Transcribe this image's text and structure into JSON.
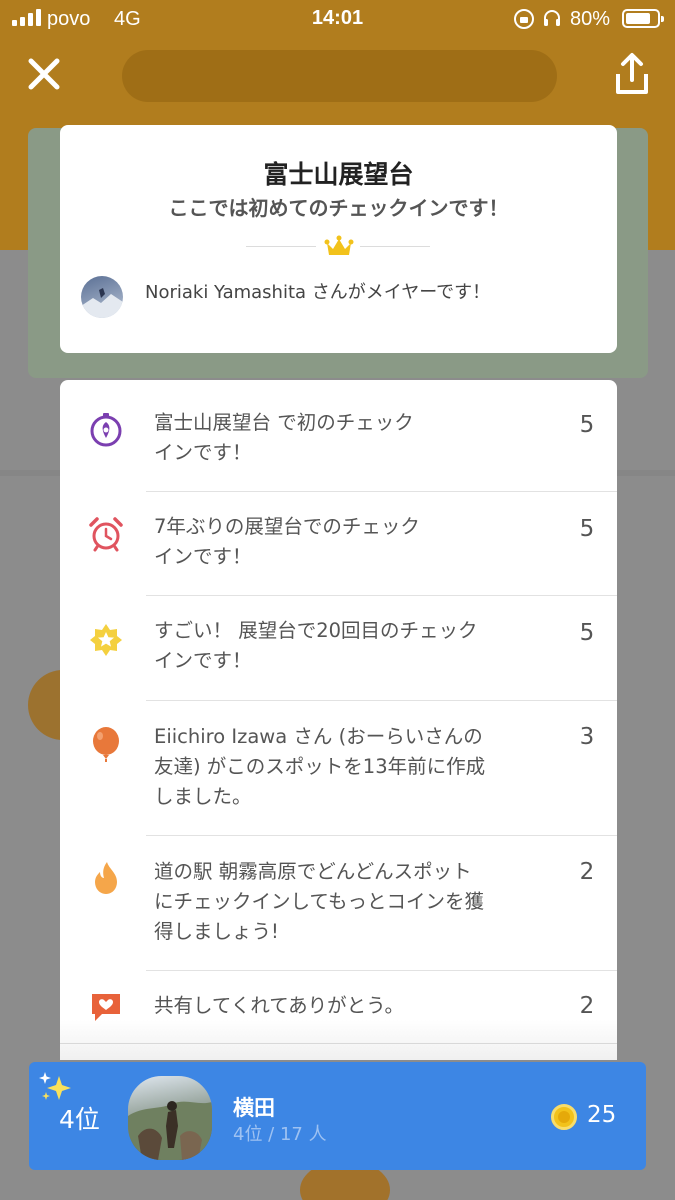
{
  "status_bar": {
    "carrier": "povo",
    "network": "4G",
    "time": "14:01",
    "battery": "80%",
    "battery_level": 0.8
  },
  "header": {
    "close_icon": "close-icon",
    "share_icon": "share-icon"
  },
  "venue_card": {
    "title": "富士山展望台",
    "subtitle": "ここでは初めてのチェックインです！",
    "mayor_text": "Noriaki Yamashita さんがメイヤーです！",
    "crown_icon": "crown-icon"
  },
  "bonuses": [
    {
      "icon": "compass-icon",
      "color": "#7b3fb0",
      "lines": [
        "富士山展望台 で初のチェック",
        "インです！"
      ],
      "points": "5"
    },
    {
      "icon": "alarm-clock-icon",
      "color": "#e0545f",
      "lines": [
        "7年ぶりの展望台でのチェック",
        "インです！"
      ],
      "points": "5"
    },
    {
      "icon": "star-badge-icon",
      "color": "#f4d03f",
      "lines": [
        "すごい！ 展望台で20回目のチェック",
        "インです！"
      ],
      "points": "5"
    },
    {
      "icon": "balloon-icon",
      "color": "#e8783a",
      "lines": [
        "Eiichiro Izawa さん (おーらいさんの",
        "友達) がこのスポットを13年前に作成",
        "しました。"
      ],
      "points": "3"
    },
    {
      "icon": "flame-icon",
      "color": "#f5a64a",
      "lines": [
        "道の駅 朝霧高原でどんどんスポット",
        "にチェックインしてもっとコインを獲",
        "得しましょう!"
      ],
      "points": "2"
    },
    {
      "icon": "heart-bubble-icon",
      "color": "#e8623a",
      "lines": [
        "共有してくれてありがとう。"
      ],
      "points": "2"
    }
  ],
  "rank_bar": {
    "rank_label": "4位",
    "user_name": "横田",
    "rank_detail": "4位 / 17 人",
    "coins": "25",
    "accent": "#3d86e4"
  }
}
